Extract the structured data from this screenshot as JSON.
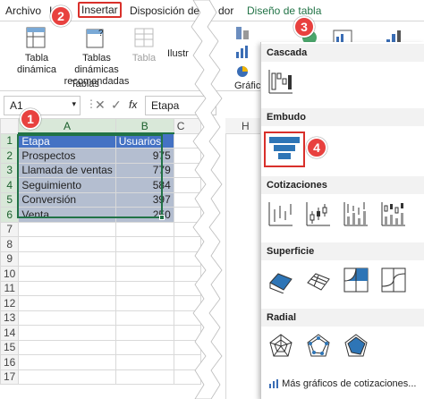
{
  "tabs": {
    "archivo": "Archivo",
    "inicio": "Ini",
    "insertar": "Insertar",
    "disposicion": "Disposición de",
    "revisar": "dor",
    "diseno": "Diseño de tabla"
  },
  "badges": [
    "1",
    "2",
    "3",
    "4"
  ],
  "ribbon": {
    "tabla_dinamica": "Tabla\ndinámica",
    "tablas_recomendadas": "Tablas dinámicas\nrecomendadas",
    "tabla": "Tabla",
    "ilustraciones": "Ilustr",
    "group_tablas": "Tablas",
    "graficos": "Gráficos"
  },
  "formula_bar": {
    "namebox": "A1",
    "fx": "fx",
    "value": "Etapa"
  },
  "sheet": {
    "columns": [
      "A",
      "B",
      "C"
    ],
    "rows": [
      "1",
      "2",
      "3",
      "4",
      "5",
      "6",
      "7",
      "8",
      "9",
      "10",
      "11",
      "12",
      "13",
      "14",
      "15",
      "16",
      "17"
    ],
    "header": [
      "Etapa",
      "Usuarios"
    ],
    "data": [
      [
        "Prospectos",
        "975"
      ],
      [
        "Llamada de ventas",
        "779"
      ],
      [
        "Seguimiento",
        "584"
      ],
      [
        "Conversión",
        "397"
      ],
      [
        "Venta",
        "250"
      ]
    ],
    "right_col_h": "H"
  },
  "menu": {
    "cascada": "Cascada",
    "embudo": "Embudo",
    "cotizaciones": "Cotizaciones",
    "superficie": "Superficie",
    "radial": "Radial",
    "mas": "Más gráficos de cotizaciones..."
  },
  "colors": {
    "accent_red": "#e8413f",
    "table_header": "#4472c4",
    "table_data": "#b4bed0",
    "excel_green": "#217346",
    "funnel_blue": "#2e75b6"
  }
}
